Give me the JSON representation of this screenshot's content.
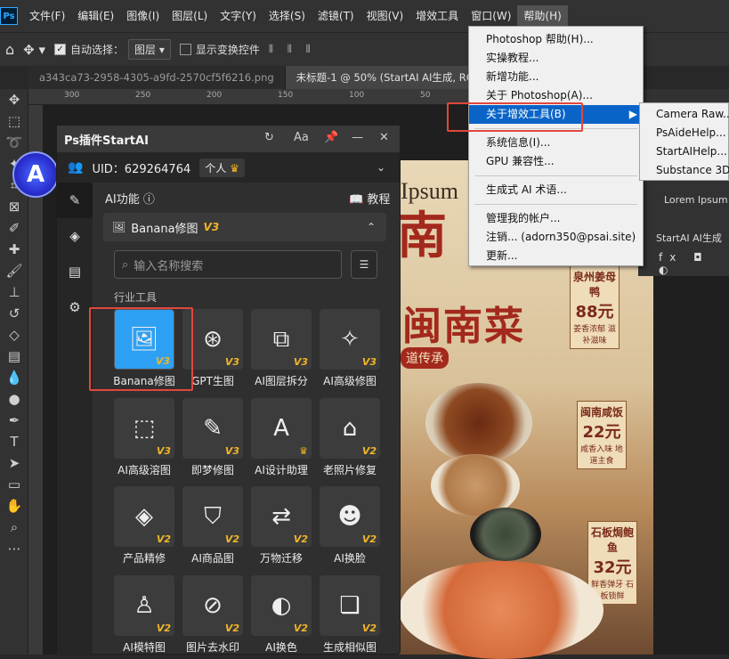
{
  "menubar": {
    "logo": "Ps",
    "items": [
      "文件(F)",
      "编辑(E)",
      "图像(I)",
      "图层(L)",
      "文字(Y)",
      "选择(S)",
      "滤镜(T)",
      "视图(V)",
      "增效工具",
      "窗口(W)",
      "帮助(H)"
    ]
  },
  "options": {
    "auto_select_label": "自动选择：",
    "auto_select_value": "图层",
    "show_transform": "显示变换控件"
  },
  "tabs": [
    "a343ca73-2958-4305-a9fd-2570cf5f6216.png",
    "未标题-1 @ 50% (StartAI AI生成, RG"
  ],
  "ruler": [
    "300",
    "250",
    "200",
    "150",
    "100",
    "50",
    "0"
  ],
  "poster": {
    "ipsum": "Ipsum",
    "nan": "南",
    "title": "闽南菜",
    "tradition": "道传承",
    "price1_name": "泉州姜母鸭",
    "price1": "88元",
    "price1_desc": "姜香浓郁 滋补滋味",
    "price2_name": "闽南咸饭",
    "price2": "22元",
    "price2_desc": "咸香入味 地道主食",
    "price3_name": "石板焗鲍鱼",
    "price3": "32元",
    "price3_desc": "鲜香弹牙 石板锁鲜"
  },
  "right": {
    "lorem": "Lorem Ipsum",
    "startai": "StartAI AI生成"
  },
  "plugin": {
    "title": "Ps插件StartAI",
    "uid": "UID：629264764",
    "personal": "个人",
    "ai_func": "AI功能",
    "tutorial": "教程",
    "section": "Banana修图",
    "section_tag": "V3",
    "search_placeholder": "输入名称搜索",
    "industry": "行业工具",
    "tools": [
      {
        "label": "Banana修图",
        "tag": "V3",
        "icon": "🖼"
      },
      {
        "label": "GPT生图",
        "tag": "V3",
        "icon": "⊛"
      },
      {
        "label": "AI图层拆分",
        "tag": "V3",
        "icon": "⧉"
      },
      {
        "label": "AI高级修图",
        "tag": "V3",
        "icon": "✧"
      },
      {
        "label": "AI高级溶图",
        "tag": "V3",
        "icon": "⬚"
      },
      {
        "label": "即梦修图",
        "tag": "V3",
        "icon": "✎"
      },
      {
        "label": "AI设计助理",
        "tag": "♛",
        "icon": "A"
      },
      {
        "label": "老照片修复",
        "tag": "V2",
        "icon": "⌂"
      },
      {
        "label": "产品精修",
        "tag": "V2",
        "icon": "◈"
      },
      {
        "label": "AI商品图",
        "tag": "V2",
        "icon": "⛉"
      },
      {
        "label": "万物迁移",
        "tag": "V2",
        "icon": "⇄"
      },
      {
        "label": "AI换脸",
        "tag": "V2",
        "icon": "☻"
      },
      {
        "label": "AI模特图",
        "tag": "V2",
        "icon": "♙"
      },
      {
        "label": "图片去水印",
        "tag": "V2",
        "icon": "⊘"
      },
      {
        "label": "AI换色",
        "tag": "V2",
        "icon": "◐"
      },
      {
        "label": "生成相似图",
        "tag": "V2",
        "icon": "❏"
      }
    ]
  },
  "help_menu": {
    "items": [
      "Photoshop 帮助(H)...",
      "实操教程...",
      "新增功能...",
      "关于 Photoshop(A)...",
      "关于增效工具(B)",
      "系统信息(I)...",
      "GPU 兼容性...",
      "生成式 AI 术语...",
      "管理我的帐户...",
      "注销... (adorn350@psai.site)",
      "更新..."
    ]
  },
  "submenu": {
    "items": [
      "Camera Raw...",
      "PsAideHelp...",
      "StartAIHelp...",
      "Substance 3D"
    ]
  }
}
